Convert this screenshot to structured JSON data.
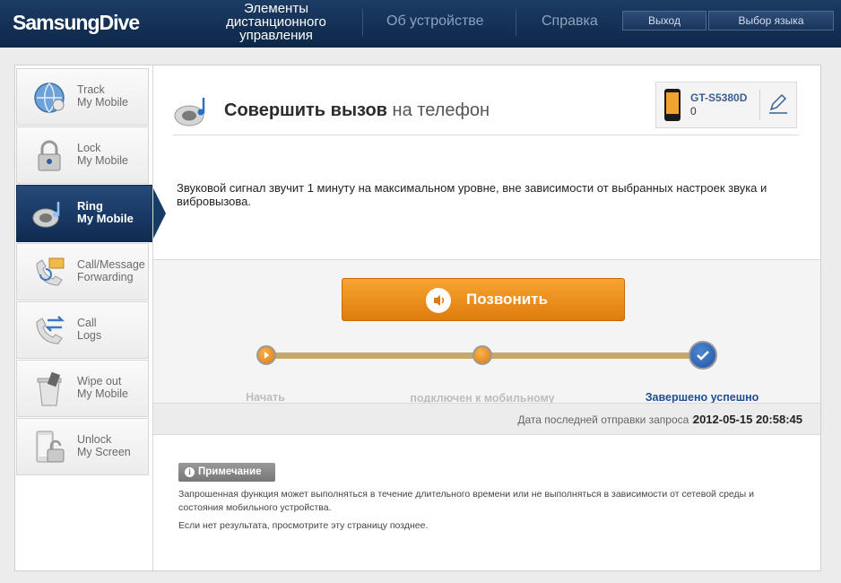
{
  "header": {
    "logo": "SamsungDive",
    "nav_remote": "Элементы дистанционного управления",
    "nav_about": "Об устройстве",
    "nav_help": "Справка",
    "logout": "Выход",
    "language": "Выбор языка"
  },
  "sidebar": {
    "items": [
      {
        "label": "Track\nMy Mobile",
        "icon": "globe-icon"
      },
      {
        "label": "Lock\nMy Mobile",
        "icon": "padlock-icon"
      },
      {
        "label": "Ring\nMy Mobile",
        "icon": "speaker-icon"
      },
      {
        "label": "Call/Message\nForwarding",
        "icon": "forward-call-icon"
      },
      {
        "label": "Call\nLogs",
        "icon": "call-logs-icon"
      },
      {
        "label": "Wipe out\nMy Mobile",
        "icon": "wipe-icon"
      },
      {
        "label": "Unlock\nMy Screen",
        "icon": "unlock-icon"
      }
    ],
    "active_index": 2
  },
  "main": {
    "title": "Совершить вызов",
    "title_sub": "на телефон",
    "device_model": "GT-S5380D",
    "device_number": "0",
    "description": "Звуковой сигнал звучит 1 минуту на максимальном уровне, вне зависимости от выбранных настроек звука и вибровызова.",
    "call_button": "Позвонить",
    "steps": [
      "Начать",
      "подключен к мобильному телефону",
      "Завершено успешно"
    ],
    "current_step": 3,
    "last_request_label": "Дата последней отправки запроса :",
    "last_request_value": "2012-05-15 20:58:45",
    "note_label": "Примечание",
    "note_text": "Запрошенная функция может выполняться в течение длительного времени или не выполняться в зависимости от сетевой среды и состояния мобильного устройства.",
    "note_text2": "Если нет результата, просмотрите эту страницу позднее."
  },
  "colors": {
    "header": "#0c2748",
    "accent_orange": "#e07c0e",
    "success_blue": "#1e4f93"
  }
}
